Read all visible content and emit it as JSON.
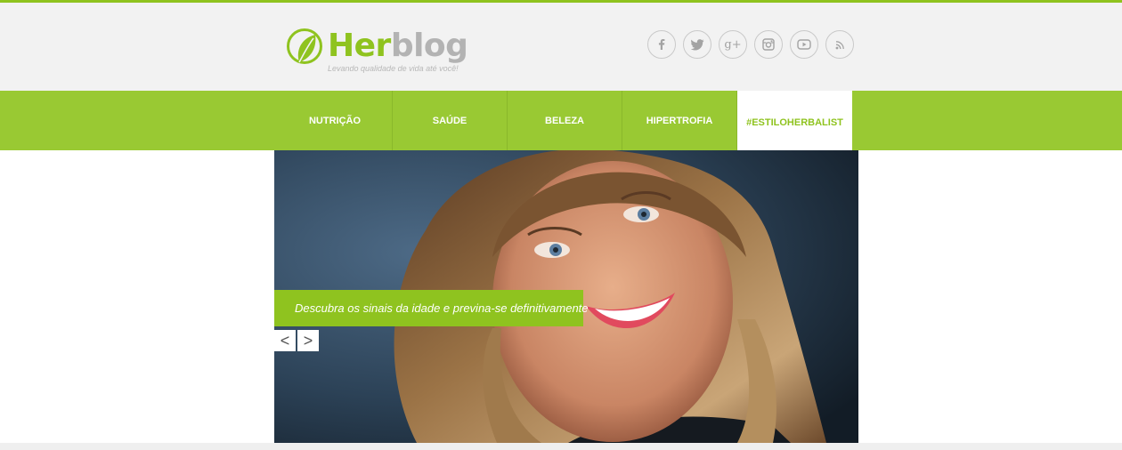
{
  "logo": {
    "name_part1": "Her",
    "name_part2": "blog",
    "tagline": "Levando qualidade de vida até você!"
  },
  "social": [
    {
      "icon": "facebook-icon"
    },
    {
      "icon": "twitter-icon"
    },
    {
      "icon": "google-plus-icon",
      "label": "g+"
    },
    {
      "icon": "instagram-icon"
    },
    {
      "icon": "youtube-icon"
    },
    {
      "icon": "rss-icon"
    }
  ],
  "nav": {
    "items": [
      {
        "label": "NUTRIÇÃO"
      },
      {
        "label": "SAÚDE"
      },
      {
        "label": "BELEZA"
      },
      {
        "label": "HIPERTROFIA"
      },
      {
        "label": "#ESTILOHERBALIST"
      }
    ],
    "active_index": 4
  },
  "slider": {
    "caption": "Descubra os sinais da idade e previna-se definitivamente",
    "prev_label": "<",
    "next_label": ">"
  },
  "colors": {
    "brand_green": "#8fc31f",
    "nav_green": "#99c933",
    "header_bg": "#f2f2f2"
  }
}
